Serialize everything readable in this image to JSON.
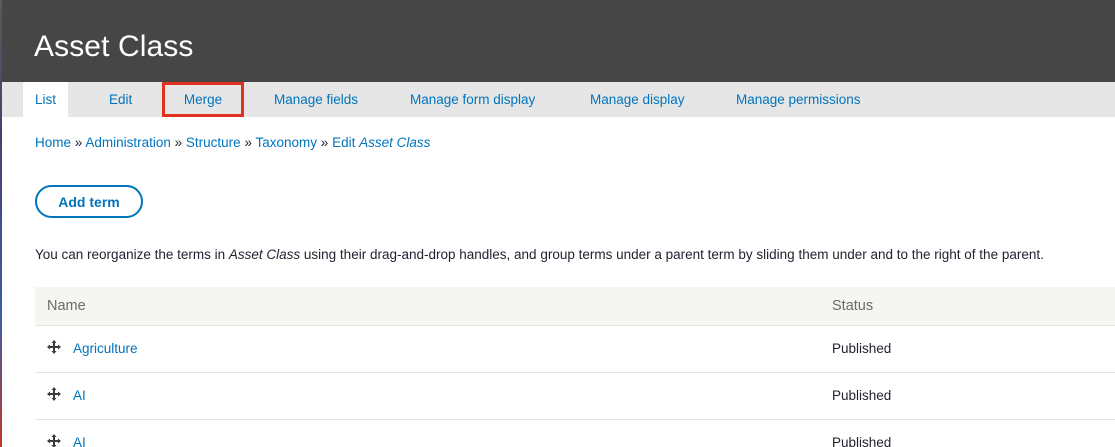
{
  "header": {
    "title": "Asset Class"
  },
  "tabs": [
    {
      "label": "List"
    },
    {
      "label": "Edit"
    },
    {
      "label": "Merge"
    },
    {
      "label": "Manage fields"
    },
    {
      "label": "Manage form display"
    },
    {
      "label": "Manage display"
    },
    {
      "label": "Manage permissions"
    }
  ],
  "breadcrumb": {
    "home": "Home",
    "administration": "Administration",
    "structure": "Structure",
    "taxonomy": "Taxonomy",
    "edit_prefix": "Edit",
    "edit_name": "Asset Class",
    "separator": "»"
  },
  "actions": {
    "add_term": "Add term"
  },
  "help": {
    "before": "You can reorganize the terms in ",
    "vocab": "Asset Class",
    "after": " using their drag-and-drop handles, and group terms under a parent term by sliding them under and to the right of the parent."
  },
  "table": {
    "columns": {
      "name": "Name",
      "status": "Status"
    },
    "rows": [
      {
        "name": "Agriculture",
        "status": "Published"
      },
      {
        "name": "AI",
        "status": "Published"
      },
      {
        "name": "AI",
        "status": "Published"
      }
    ]
  },
  "colors": {
    "header_bg": "#464646",
    "tab_bar_bg": "#e6e6e6",
    "link": "#0074bd",
    "highlight": "#e0321f"
  }
}
